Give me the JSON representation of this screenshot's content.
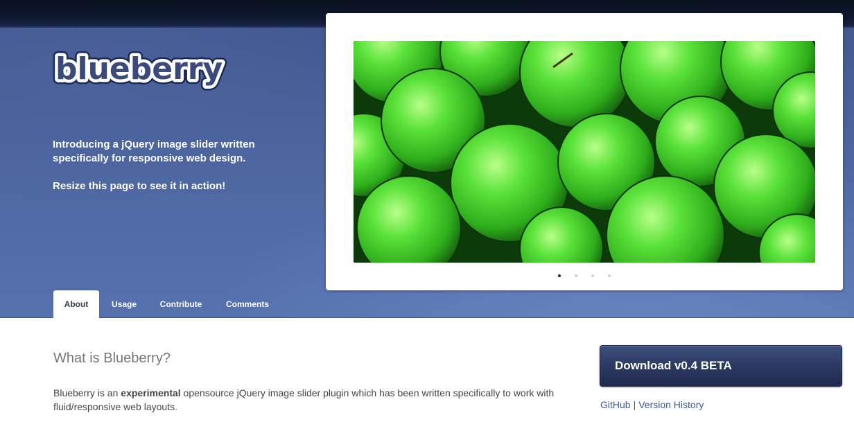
{
  "brand": {
    "logo_text": "blueberry"
  },
  "hero": {
    "intro_line": "Introducing a jQuery image slider written specifically for responsive web design.",
    "resize_line": "Resize this page to see it in action!"
  },
  "slider": {
    "image_description": "green-apples-photo",
    "slide_count": 4,
    "active_slide": 1
  },
  "tabs": [
    {
      "label": "About",
      "active": true
    },
    {
      "label": "Usage",
      "active": false
    },
    {
      "label": "Contribute",
      "active": false
    },
    {
      "label": "Comments",
      "active": false
    }
  ],
  "main": {
    "heading": "What is Blueberry?",
    "para_start": "Blueberry is an ",
    "para_bold": "experimental",
    "para_end": " opensource jQuery image slider plugin which has been written specifically to work with fluid/responsive web layouts."
  },
  "sidebar": {
    "download_label": "Download v0.4 BETA",
    "github_label": "GitHub",
    "separator": "|",
    "history_label": "Version History"
  },
  "colors": {
    "hero_bg": "#4d66a0",
    "topbar_bg": "#0f1933",
    "button_bg": "#2c3a63",
    "link": "#3b5b93",
    "apple_green": "#4fd62e"
  }
}
